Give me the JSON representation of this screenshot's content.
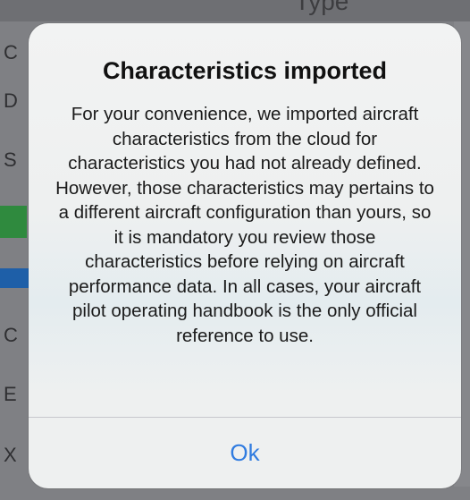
{
  "background": {
    "top_label": "Type",
    "row_letters": [
      "C",
      "D",
      "S",
      "C",
      "E",
      "X"
    ],
    "accent_green": "#2f8a3e",
    "accent_blue": "#1e5fa8"
  },
  "alert": {
    "title": "Characteristics imported",
    "message": "For your convenience, we imported aircraft characteristics from the cloud for characteristics you had not already defined. However, those characteristics may pertains to a different aircraft configuration than yours, so it is mandatory you review those characteristics before relying on aircraft performance data. In all cases, your aircraft pilot operating handbook is the only official reference to use.",
    "ok_label": "Ok",
    "ok_color": "#2f7be0"
  }
}
